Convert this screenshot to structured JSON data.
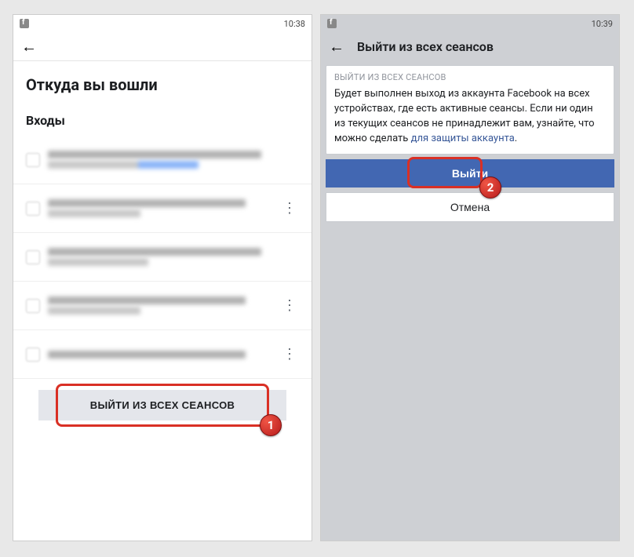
{
  "left": {
    "time": "10:38",
    "page_title": "Откуда вы вошли",
    "section_title": "Входы",
    "sessions": [
      {
        "has_more": false
      },
      {
        "has_more": true
      },
      {
        "has_more": false
      },
      {
        "has_more": true
      },
      {
        "has_more": true
      }
    ],
    "logout_all": "ВЫЙТИ ИЗ ВСЕХ СЕАНСОВ",
    "badge": "1"
  },
  "right": {
    "time": "10:39",
    "header_title": "Выйти из всех сеансов",
    "card_header": "ВЫЙТИ ИЗ ВСЕХ СЕАНСОВ",
    "card_text_1": "Будет выполнен выход из аккаунта Facebook на всех устройствах, где есть активные сеансы. Если ни один из текущих сеансов не принадлежит вам, узнайте, что можно сделать ",
    "card_link": "для защиты аккаунта",
    "card_text_2": ".",
    "logout_btn": "Выйти",
    "cancel_btn": "Отмена",
    "badge": "2"
  }
}
